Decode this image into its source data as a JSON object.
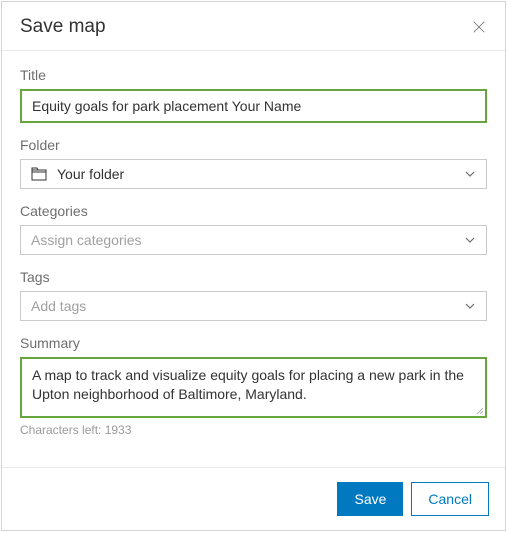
{
  "modal": {
    "title": "Save map"
  },
  "form": {
    "title": {
      "label": "Title",
      "value": "Equity goals for park placement Your Name"
    },
    "folder": {
      "label": "Folder",
      "value": "Your folder"
    },
    "categories": {
      "label": "Categories",
      "placeholder": "Assign categories"
    },
    "tags": {
      "label": "Tags",
      "placeholder": "Add tags"
    },
    "summary": {
      "label": "Summary",
      "value": "A map to track and visualize equity goals for placing a new park in the Upton neighborhood of Baltimore, Maryland.",
      "char_count": "Characters left: 1933"
    }
  },
  "buttons": {
    "save": "Save",
    "cancel": "Cancel"
  }
}
